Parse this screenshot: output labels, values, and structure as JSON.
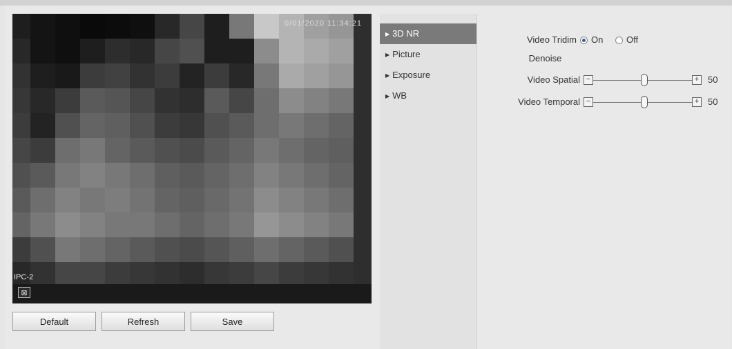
{
  "video": {
    "osd_time": "0/01/2020 11:34:21",
    "osd_channel": "IPC-2"
  },
  "buttons": {
    "default": "Default",
    "refresh": "Refresh",
    "save": "Save"
  },
  "menu": {
    "items": [
      {
        "label": "3D NR",
        "active": true
      },
      {
        "label": "Picture",
        "active": false
      },
      {
        "label": "Exposure",
        "active": false
      },
      {
        "label": "WB",
        "active": false
      }
    ]
  },
  "settings": {
    "tridim_label_line1": "Video Tridim",
    "tridim_label_line2": "Denoise",
    "on_label": "On",
    "off_label": "Off",
    "selected": "On",
    "spatial_label": "Video Spatial",
    "spatial_value": "50",
    "temporal_label": "Video Temporal",
    "temporal_value": "50"
  },
  "icons": {
    "fit": "fit-window-icon",
    "menu_arrow": "triangle-right-icon",
    "minus": "minus-icon",
    "plus": "plus-icon"
  }
}
